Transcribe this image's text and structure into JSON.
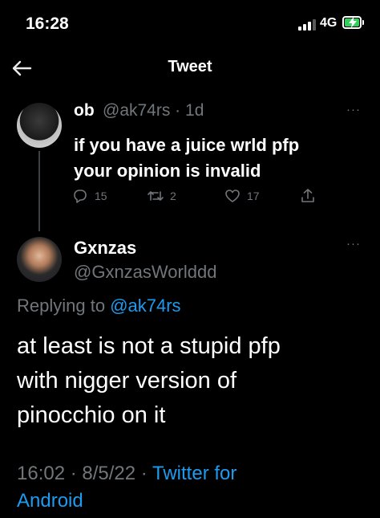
{
  "status_bar": {
    "time": "16:28",
    "network": "4G",
    "battery_charging": true
  },
  "header": {
    "title": "Tweet",
    "back_icon": "arrow-left-icon"
  },
  "parent_tweet": {
    "name": "ob",
    "handle_time": "@ak74rs · 1d",
    "text": "if you have a juice wrld pfp\nyour opinion is invalid",
    "replies": "15",
    "retweets": "2",
    "likes": "17",
    "more_label": "···"
  },
  "reply_tweet": {
    "name": "Gxnzas",
    "handle": "@GxnzasWorlddd",
    "replying_prefix": "Replying to ",
    "replying_to": "@ak74rs",
    "text": "at least is not a stupid pfp\nwith nigger version of\npinocchio on it",
    "timestamp": "16:02 · 8/5/22 · ",
    "source": "Twitter for\nAndroid",
    "more_label": "···"
  },
  "colors": {
    "background": "#000000",
    "text": "#e7e9ea",
    "secondary": "#71767b",
    "accent": "#1d9bf0",
    "battery": "#30d158"
  }
}
